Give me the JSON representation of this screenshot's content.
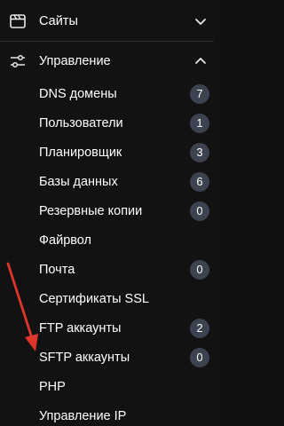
{
  "sections": [
    {
      "label": "Сайты",
      "icon": "browser-window-icon",
      "expanded": false
    },
    {
      "label": "Управление",
      "icon": "sliders-icon",
      "expanded": true
    }
  ],
  "menu": [
    {
      "label": "DNS домены",
      "badge": "7"
    },
    {
      "label": "Пользователи",
      "badge": "1"
    },
    {
      "label": "Планировщик",
      "badge": "3"
    },
    {
      "label": "Базы данных",
      "badge": "6"
    },
    {
      "label": "Резервные копии",
      "badge": "0"
    },
    {
      "label": "Файрвол",
      "badge": ""
    },
    {
      "label": "Почта",
      "badge": "0"
    },
    {
      "label": "Сертификаты SSL",
      "badge": ""
    },
    {
      "label": "FTP аккаунты",
      "badge": "2"
    },
    {
      "label": "SFTP аккаунты",
      "badge": "0"
    },
    {
      "label": "PHP",
      "badge": ""
    },
    {
      "label": "Управление IP",
      "badge": ""
    }
  ],
  "colors": {
    "background": "#121212",
    "badge": "#3d4250",
    "annotation_arrow": "#e0352b"
  }
}
